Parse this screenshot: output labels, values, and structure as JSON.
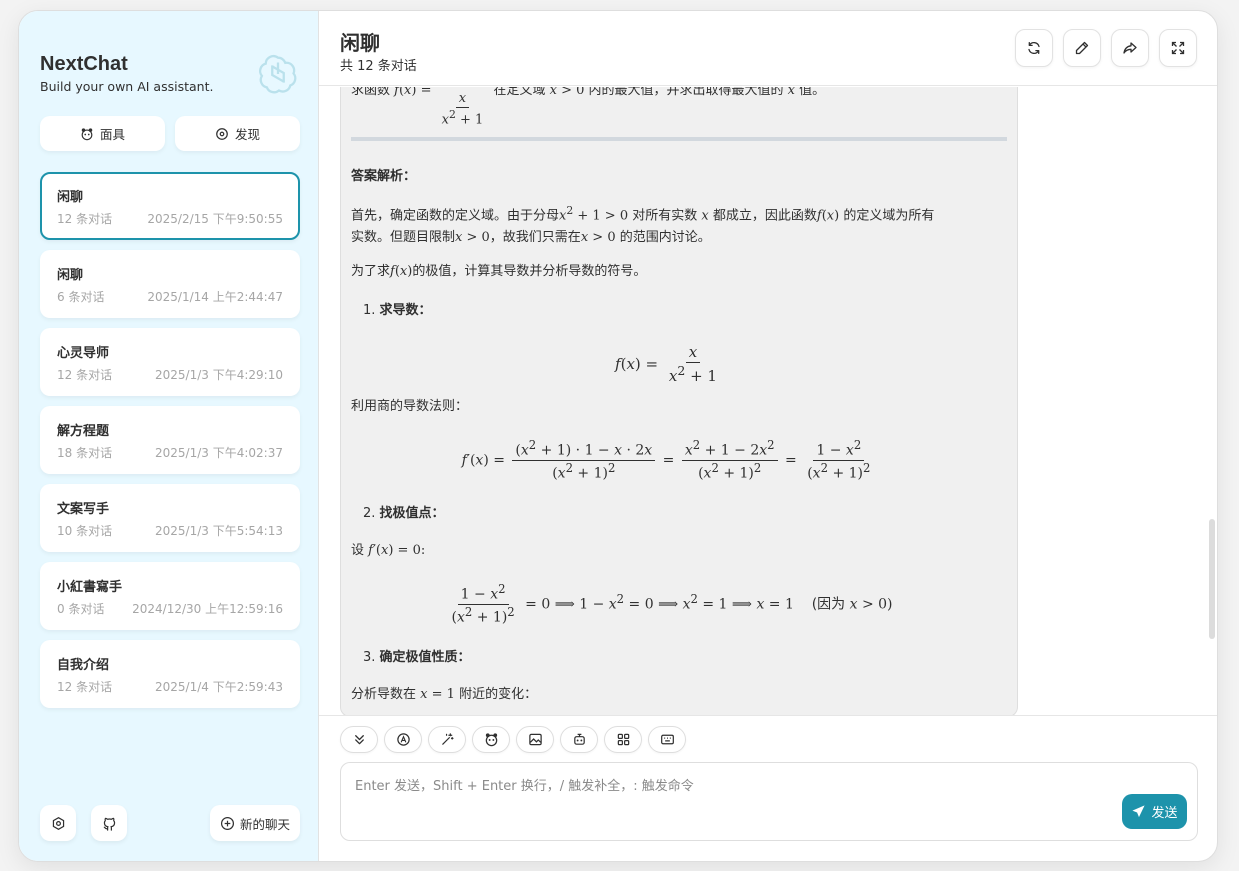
{
  "sidebar": {
    "title": "NextChat",
    "subtitle": "Build your own AI assistant.",
    "mask_label": "面具",
    "discover_label": "发现",
    "chats": [
      {
        "title": "闲聊",
        "count": "12 条对话",
        "time": "2025/2/15 下午9:50:55",
        "active": true
      },
      {
        "title": "闲聊",
        "count": "6 条对话",
        "time": "2025/1/14 上午2:44:47"
      },
      {
        "title": "心灵导师",
        "count": "12 条对话",
        "time": "2025/1/3 下午4:29:10"
      },
      {
        "title": "解方程题",
        "count": "18 条对话",
        "time": "2025/1/3 下午4:02:37"
      },
      {
        "title": "文案写手",
        "count": "10 条对话",
        "time": "2025/1/3 下午5:54:13"
      },
      {
        "title": "小紅書寫手",
        "count": "0 条对话",
        "time": "2024/12/30 上午12:59:16"
      },
      {
        "title": "自我介绍",
        "count": "12 条对话",
        "time": "2025/1/4 下午2:59:43"
      }
    ],
    "new_chat_label": "新的聊天"
  },
  "header": {
    "title": "闲聊",
    "subtitle": "共 12 条对话"
  },
  "message": {
    "q_prefix": "求函数",
    "q_suffix1": "在定义域",
    "q_suffix2": "内的最大值，并求出取得最大值的",
    "q_suffix3": "值。",
    "answer_heading": "答案解析：",
    "p1a": "首先，确定函数的定义域。由于分母",
    "p1b": "对所有实数",
    "p1c": "都成立，因此函数",
    "p1d": "的定义域为所有",
    "p1e": "实数。但题目限制",
    "p1f": "，故我们只需在",
    "p1g": "的范围内讨论。",
    "p2a": "为了求",
    "p2b": "的极值，计算其导数并分析导数的符号。",
    "step1": "求导数：",
    "rule": "利用商的导数法则：",
    "step2": "找极值点：",
    "set_a": "设",
    "because": "(因为",
    "step3": "确定极值性质：",
    "analyze_a": "分析导数在",
    "analyze_b": "附近的变化："
  },
  "composer": {
    "placeholder": "Enter 发送，Shift + Enter 换行，/ 触发补全，: 触发命令",
    "send_label": "发送"
  },
  "colors": {
    "accent": "#1d93ab",
    "sidebar_bg": "#e7f8ff"
  }
}
